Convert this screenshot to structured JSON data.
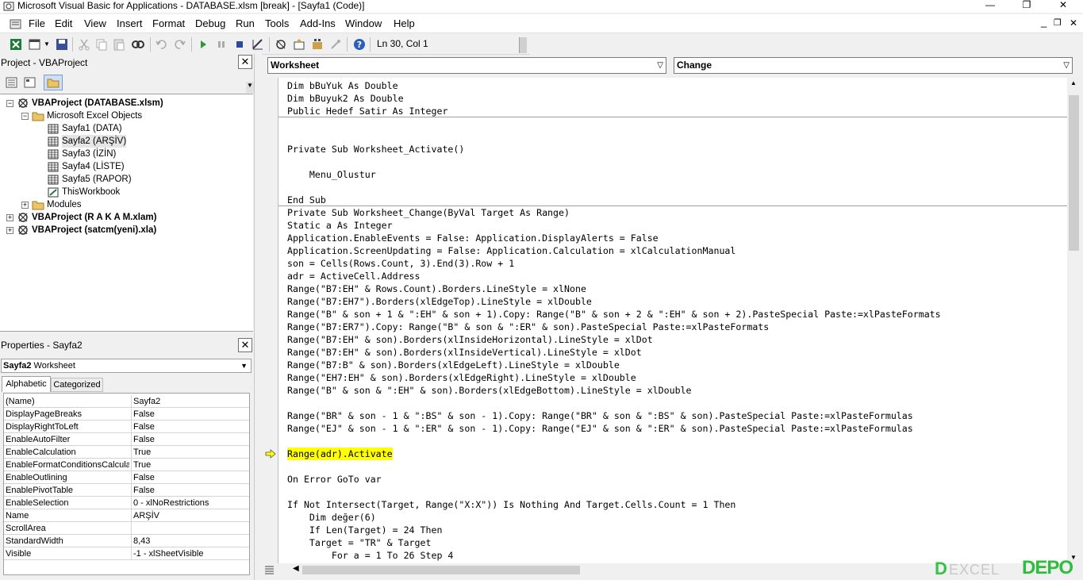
{
  "window": {
    "title": "Microsoft Visual Basic for Applications - DATABASE.xlsm [break] - [Sayfa1 (Code)]",
    "minimize_glyph": "—",
    "restore_glyph": "❐",
    "close_glyph": "✕",
    "doc_minimize_glyph": "_",
    "doc_restore_glyph": "❐",
    "doc_close_glyph": "✕"
  },
  "menu": [
    "File",
    "Edit",
    "View",
    "Insert",
    "Format",
    "Debug",
    "Run",
    "Tools",
    "Add-Ins",
    "Window",
    "Help"
  ],
  "toolbar": {
    "position": "Ln 30, Col 1"
  },
  "project_panel": {
    "title": "Project - VBAProject",
    "close_glyph": "✕",
    "tree": [
      {
        "label": "VBAProject (DATABASE.xlsm)",
        "level": 0,
        "bold": true,
        "expander": "−",
        "icon": "vba-project-icon"
      },
      {
        "label": "Microsoft Excel Objects",
        "level": 1,
        "bold": false,
        "expander": "−",
        "icon": "folder-icon"
      },
      {
        "label": "Sayfa1 (DATA)",
        "level": 2,
        "bold": false,
        "expander": "",
        "icon": "sheet-icon"
      },
      {
        "label": "Sayfa2 (ARŞİV)",
        "level": 2,
        "bold": false,
        "expander": "",
        "icon": "sheet-icon"
      },
      {
        "label": "Sayfa3 (İZİN)",
        "level": 2,
        "bold": false,
        "expander": "",
        "icon": "sheet-icon"
      },
      {
        "label": "Sayfa4 (LİSTE)",
        "level": 2,
        "bold": false,
        "expander": "",
        "icon": "sheet-icon"
      },
      {
        "label": "Sayfa5 (RAPOR)",
        "level": 2,
        "bold": false,
        "expander": "",
        "icon": "sheet-icon"
      },
      {
        "label": "ThisWorkbook",
        "level": 2,
        "bold": false,
        "expander": "",
        "icon": "workbook-icon"
      },
      {
        "label": "Modules",
        "level": 1,
        "bold": false,
        "expander": "+",
        "icon": "folder-icon"
      },
      {
        "label": "VBAProject (R A K A M.xlam)",
        "level": 0,
        "bold": true,
        "expander": "+",
        "icon": "vba-project-icon"
      },
      {
        "label": "VBAProject (satcm(yeni).xla)",
        "level": 0,
        "bold": true,
        "expander": "+",
        "icon": "vba-project-icon"
      }
    ]
  },
  "properties_panel": {
    "title": "Properties - Sayfa2",
    "close_glyph": "✕",
    "object_name": "Sayfa2",
    "object_type": "Worksheet",
    "tabs": [
      "Alphabetic",
      "Categorized"
    ],
    "rows": [
      {
        "name": "(Name)",
        "value": "Sayfa2"
      },
      {
        "name": "DisplayPageBreaks",
        "value": "False"
      },
      {
        "name": "DisplayRightToLeft",
        "value": "False"
      },
      {
        "name": "EnableAutoFilter",
        "value": "False"
      },
      {
        "name": "EnableCalculation",
        "value": "True"
      },
      {
        "name": "EnableFormatConditionsCalculati",
        "value": "True"
      },
      {
        "name": "EnableOutlining",
        "value": "False"
      },
      {
        "name": "EnablePivotTable",
        "value": "False"
      },
      {
        "name": "EnableSelection",
        "value": "0 - xlNoRestrictions"
      },
      {
        "name": "Name",
        "value": "ARŞİV"
      },
      {
        "name": "ScrollArea",
        "value": ""
      },
      {
        "name": "StandardWidth",
        "value": "8,43"
      },
      {
        "name": "Visible",
        "value": "-1 - xlSheetVisible"
      }
    ]
  },
  "code_window": {
    "object_combo": "Worksheet",
    "procedure_combo": "Change",
    "current_line_index": 29,
    "separator_after": [
      2,
      9
    ],
    "lines": [
      "Dim bBuYuk As Double",
      "Dim bBuyuk2 As Double",
      "Public Hedef Satir As Integer",
      "",
      "",
      "Private Sub Worksheet_Activate()",
      "",
      "    Menu_Olustur",
      "",
      "End Sub",
      "Private Sub Worksheet_Change(ByVal Target As Range)",
      "Static a As Integer",
      "Application.EnableEvents = False: Application.DisplayAlerts = False",
      "Application.ScreenUpdating = False: Application.Calculation = xlCalculationManual",
      "son = Cells(Rows.Count, 3).End(3).Row + 1",
      "adr = ActiveCell.Address",
      "Range(\"B7:EH\" & Rows.Count).Borders.LineStyle = xlNone",
      "Range(\"B7:EH7\").Borders(xlEdgeTop).LineStyle = xlDouble",
      "Range(\"B\" & son + 1 & \":EH\" & son + 1).Copy: Range(\"B\" & son + 2 & \":EH\" & son + 2).PasteSpecial Paste:=xlPasteFormats",
      "Range(\"B7:ER7\").Copy: Range(\"B\" & son & \":ER\" & son).PasteSpecial Paste:=xlPasteFormats",
      "Range(\"B7:EH\" & son).Borders(xlInsideHorizontal).LineStyle = xlDot",
      "Range(\"B7:EH\" & son).Borders(xlInsideVertical).LineStyle = xlDot",
      "Range(\"B7:B\" & son).Borders(xlEdgeLeft).LineStyle = xlDouble",
      "Range(\"EH7:EH\" & son).Borders(xlEdgeRight).LineStyle = xlDouble",
      "Range(\"B\" & son & \":EH\" & son).Borders(xlEdgeBottom).LineStyle = xlDouble",
      "",
      "Range(\"BR\" & son - 1 & \":BS\" & son - 1).Copy: Range(\"BR\" & son & \":BS\" & son).PasteSpecial Paste:=xlPasteFormulas",
      "Range(\"EJ\" & son - 1 & \":ER\" & son - 1).Copy: Range(\"EJ\" & son & \":ER\" & son).PasteSpecial Paste:=xlPasteFormulas",
      "",
      "Range(adr).Activate",
      "",
      "On Error GoTo var",
      "",
      "If Not Intersect(Target, Range(\"X:X\")) Is Nothing And Target.Cells.Count = 1 Then",
      "    Dim değer(6)",
      "    If Len(Target) = 24 Then",
      "    Target = \"TR\" & Target",
      "        For a = 1 To 26 Step 4"
    ]
  },
  "watermark": {
    "text": "EXCEL",
    "brand": "DEPO"
  },
  "colors": {
    "highlight": "#ffff00",
    "arrow": "#ffff00",
    "brand_green": "#2ebd3c"
  }
}
